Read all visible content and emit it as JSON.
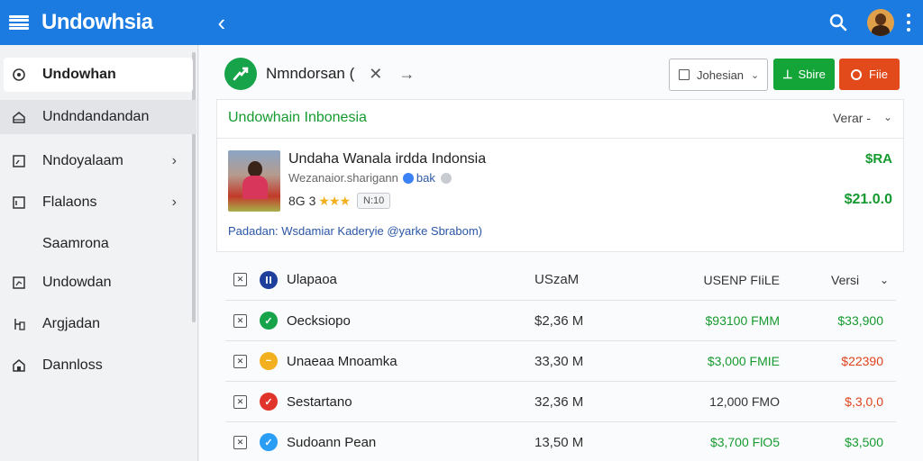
{
  "app": {
    "title": "Undowhsia"
  },
  "sidebar": {
    "items": [
      {
        "label": "Undowhan",
        "icon": "eye-icon"
      },
      {
        "label": "Undndandandan",
        "icon": "home-icon"
      },
      {
        "label": "Nndoyalaam",
        "icon": "folder-icon"
      },
      {
        "label": "Flalaons",
        "icon": "document-icon"
      },
      {
        "label": "Saamrona",
        "icon": ""
      },
      {
        "label": "Undowdan",
        "icon": "chart-icon"
      },
      {
        "label": "Argjadan",
        "icon": "hierarchy-icon"
      },
      {
        "label": "Dannloss",
        "icon": "building-icon"
      }
    ]
  },
  "header": {
    "title": "Nmndorsan (",
    "close": "✕",
    "arrow": "→",
    "dropdown_label": "Johesian",
    "green_button": "Sbire",
    "red_button": "Fiie"
  },
  "card": {
    "title": "Undowhain Inbonesia",
    "sort_label": "Verar -",
    "product_title": "Undaha Wanala irdda Indonsia",
    "product_sub": "Wezanaior.sharigann",
    "product_badge": "bak",
    "rating_value": "8G 3",
    "stars": "★★★",
    "chip": "N:10",
    "price_1": "$RA",
    "price_2": "$21.0.0",
    "link": "Padadan: Wsdamiar Kaderyie @yarke Sbrabom)"
  },
  "table": {
    "headers": {
      "name": "Ulapaoa",
      "size": "USzaM",
      "file": "USENP FIiLE",
      "version": "Versi"
    },
    "rows": [
      {
        "name": "Oecksiopo",
        "size": "$2,36 M",
        "file": "$93100 FMM",
        "version": "$33,900",
        "status": "check",
        "status_color": "#16a34a",
        "file_color": "#169a2f",
        "version_color": "#169a2f"
      },
      {
        "name": "Unaeaa Mnoamka",
        "size": "33,30 M",
        "file": "$3,000 FMIE",
        "version": "$22390",
        "status": "dash",
        "status_color": "#f2b01e",
        "file_color": "#169a2f",
        "version_color": "#e0421e"
      },
      {
        "name": "Sestartano",
        "size": "32,36 M",
        "file": "12,000 FMO",
        "version": "$,3,0,0",
        "status": "check",
        "status_color": "#e0332b",
        "file_color": "#333333",
        "version_color": "#e0421e"
      },
      {
        "name": "Sudoann Pean",
        "size": "13,50 M",
        "file": "$3,700 FlO5",
        "version": "$3,500",
        "status": "check",
        "status_color": "#2a9df4",
        "file_color": "#169a2f",
        "version_color": "#169a2f"
      }
    ]
  },
  "colors": {
    "appbar": "#1c7be0",
    "accent_green": "#13a538",
    "accent_red": "#e24a1b"
  }
}
